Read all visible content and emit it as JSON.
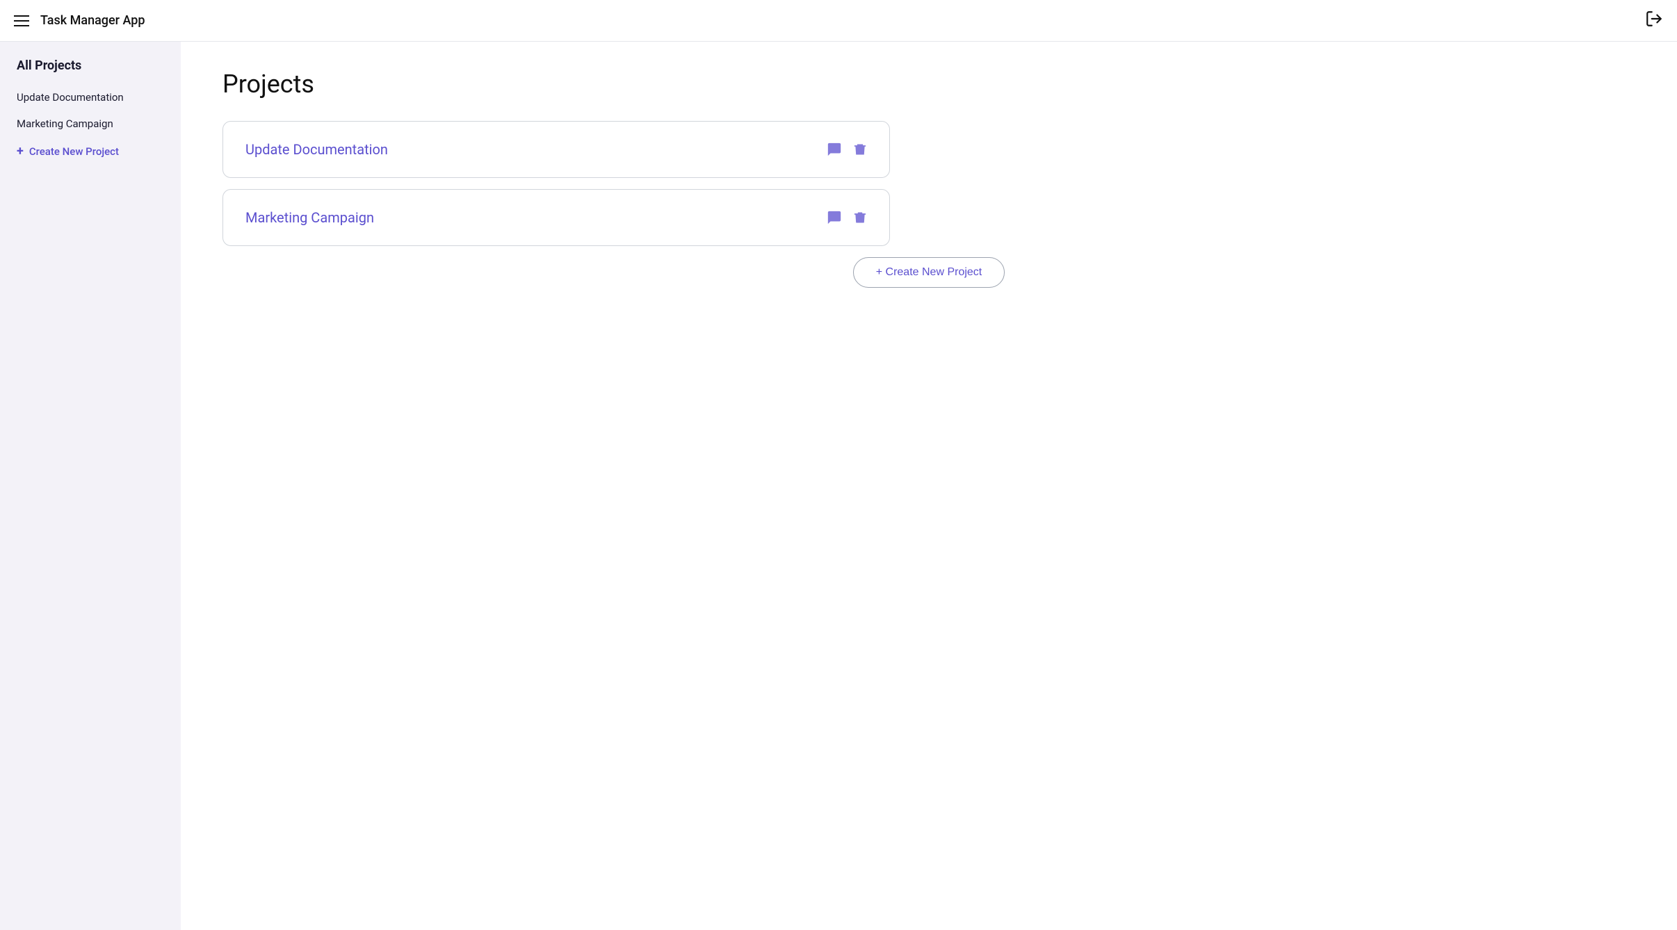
{
  "header": {
    "title": "Task Manager App",
    "logout_label": "logout"
  },
  "sidebar": {
    "heading": "All Projects",
    "items": [
      {
        "label": "Update Documentation"
      },
      {
        "label": "Marketing Campaign"
      }
    ],
    "create_label": "Create New Project"
  },
  "main": {
    "page_title": "Projects",
    "projects": [
      {
        "name": "Update Documentation"
      },
      {
        "name": "Marketing Campaign"
      }
    ],
    "create_button_label": "+ Create New Project"
  }
}
